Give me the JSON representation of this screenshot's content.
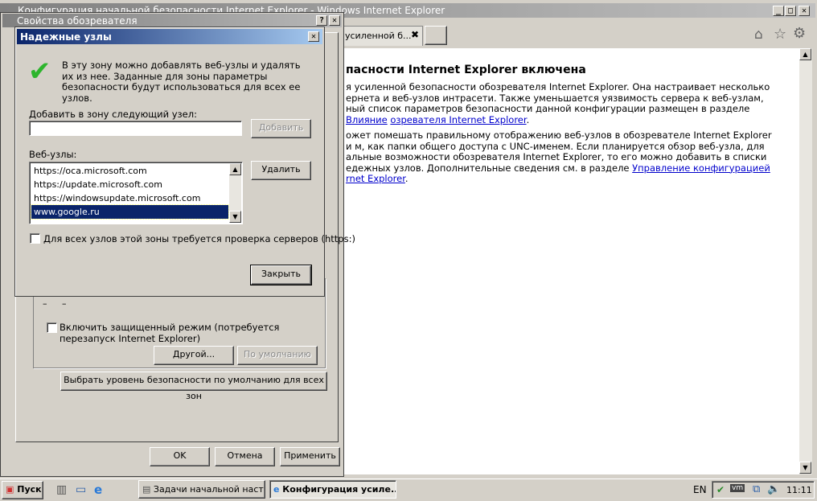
{
  "ie": {
    "title": "Конфигурация начальной безопасности Internet Explorer - Windows Internet Explorer",
    "tab_label": "усиленной б...",
    "heading": "пасности Internet Explorer включена",
    "para1": "я усиленной безопасности обозревателя Internet Explorer. Она настраивает несколько ернета и веб-узлов интрасети. Также уменьшается уязвимость сервера к веб-узлам, ный список параметров безопасности данной конфигурации размещен в разделе ",
    "para1_link": "Влияние",
    "para1_link2": "озревателя Internet Explorer",
    "para2": "ожет помешать правильному отображению веб-узлов в обозревателе Internet Explorer и м, как папки общего доступа с UNC-именем. Если планируется обзор веб-узла, для альные возможности обозревателя Internet Explorer, то его можно добавить в списки едежных узлов. Дополнительные сведения см. в разделе ",
    "para2_link": "Управление конфигурацией",
    "para2_link2": "rnet Explorer"
  },
  "props": {
    "title": "Свойства обозревателя",
    "protected_mode": "Включить защищенный режим (потребуется перезапуск Internet Explorer)",
    "custom_btn": "Другой...",
    "default_btn": "По умолчанию",
    "reset_all_btn": "Выбрать уровень безопасности по умолчанию для всех зон",
    "ok": "OK",
    "cancel": "Отмена",
    "apply": "Применить"
  },
  "trusted": {
    "title": "Надежные узлы",
    "info": "В эту зону можно добавлять веб-узлы и удалять их из нее. Заданные для зоны параметры безопасности будут использоваться для всех ее узлов.",
    "add_label": "Добавить в зону следующий узел:",
    "add_value": "",
    "add_btn": "Добавить",
    "sites_label": "Веб-узлы:",
    "sites": [
      "https://oca.microsoft.com",
      "https://update.microsoft.com",
      "https://windowsupdate.microsoft.com",
      "www.google.ru"
    ],
    "remove_btn": "Удалить",
    "require_https": "Для всех узлов этой зоны требуется проверка серверов (https:)",
    "close_btn": "Закрыть"
  },
  "taskbar": {
    "start": "Пуск",
    "task1": "Задачи начальной наст...",
    "task2": "Конфигурация усиле...",
    "lang": "EN",
    "clock": "11:11"
  }
}
